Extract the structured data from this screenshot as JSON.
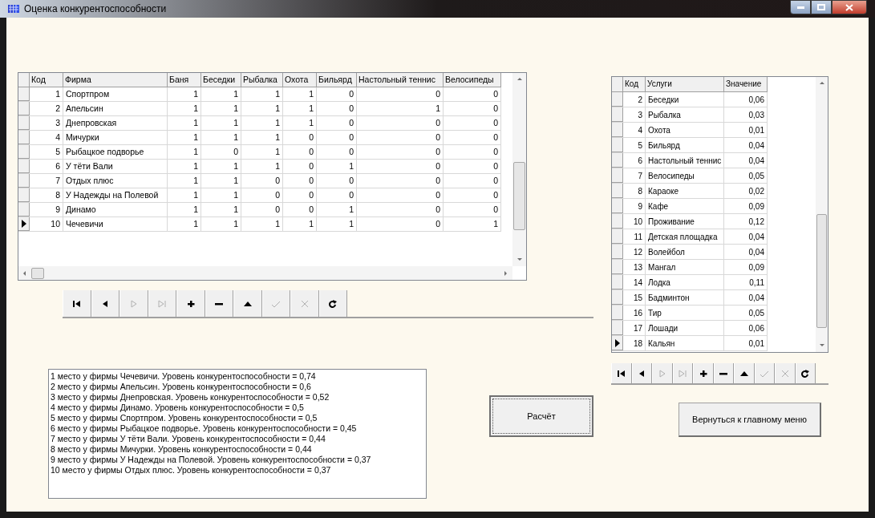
{
  "window": {
    "title": "Оценка конкурентоспособности"
  },
  "firms_grid": {
    "columns": [
      {
        "label": "Код",
        "kind": "number"
      },
      {
        "label": "Фирма",
        "kind": "text"
      },
      {
        "label": "Баня",
        "kind": "number"
      },
      {
        "label": "Беседки",
        "kind": "number"
      },
      {
        "label": "Рыбалка",
        "kind": "number"
      },
      {
        "label": "Охота",
        "kind": "number"
      },
      {
        "label": "Бильярд",
        "kind": "number"
      },
      {
        "label": "Настольный теннис",
        "kind": "number"
      },
      {
        "label": "Велосипеды",
        "kind": "number"
      }
    ],
    "rows": [
      {
        "cells": [
          "1",
          "Спортпром",
          "1",
          "1",
          "1",
          "1",
          "0",
          "0",
          "0"
        ],
        "selected": false
      },
      {
        "cells": [
          "2",
          "Апельсин",
          "1",
          "1",
          "1",
          "1",
          "0",
          "1",
          "0"
        ],
        "selected": false
      },
      {
        "cells": [
          "3",
          "Днепровская",
          "1",
          "1",
          "1",
          "1",
          "0",
          "0",
          "0"
        ],
        "selected": false
      },
      {
        "cells": [
          "4",
          "Мичурки",
          "1",
          "1",
          "1",
          "0",
          "0",
          "0",
          "0"
        ],
        "selected": false
      },
      {
        "cells": [
          "5",
          "Рыбацкое подворье",
          "1",
          "0",
          "1",
          "0",
          "0",
          "0",
          "0"
        ],
        "selected": false
      },
      {
        "cells": [
          "6",
          "У тёти Вали",
          "1",
          "1",
          "1",
          "0",
          "1",
          "0",
          "0"
        ],
        "selected": false
      },
      {
        "cells": [
          "7",
          "Отдых плюс",
          "1",
          "1",
          "0",
          "0",
          "0",
          "0",
          "0"
        ],
        "selected": false
      },
      {
        "cells": [
          "8",
          "У Надежды на Полевой",
          "1",
          "1",
          "0",
          "0",
          "0",
          "0",
          "0"
        ],
        "selected": false
      },
      {
        "cells": [
          "9",
          "Динамо",
          "1",
          "1",
          "0",
          "0",
          "1",
          "0",
          "0"
        ],
        "selected": false
      },
      {
        "cells": [
          "10",
          "Чечевичи",
          "1",
          "1",
          "1",
          "1",
          "1",
          "0",
          "1"
        ],
        "selected": true
      }
    ]
  },
  "firms_navigator": [
    {
      "kind": "first",
      "disabled": false
    },
    {
      "kind": "prior",
      "disabled": false
    },
    {
      "kind": "next",
      "disabled": true
    },
    {
      "kind": "last",
      "disabled": true
    },
    {
      "kind": "insert",
      "disabled": false
    },
    {
      "kind": "delete",
      "disabled": false
    },
    {
      "kind": "edit",
      "disabled": false
    },
    {
      "kind": "post",
      "disabled": true
    },
    {
      "kind": "cancel",
      "disabled": true
    },
    {
      "kind": "refresh",
      "disabled": false
    }
  ],
  "results": [
    "1 место у фирмы Чечевичи. Уровень конкурентоспособности = 0,74",
    "2 место у фирмы Апельсин. Уровень конкурентоспособности = 0,6",
    "3 место у фирмы Днепровская. Уровень конкурентоспособности = 0,52",
    "4 место у фирмы Динамо. Уровень конкурентоспособности = 0,5",
    "5 место у фирмы Спортпром. Уровень конкурентоспособности = 0,5",
    "6 место у фирмы Рыбацкое подворье. Уровень конкурентоспособности = 0,45",
    "7 место у фирмы У тёти Вали. Уровень конкурентоспособности = 0,44",
    "8 место у фирмы Мичурки. Уровень конкурентоспособности = 0,44",
    "9 место у фирмы У Надежды на Полевой. Уровень конкурентоспособности = 0,37",
    "10 место у фирмы Отдых плюс. Уровень конкурентоспособности = 0,37"
  ],
  "calculate_button": "Расчёт",
  "services_grid": {
    "columns": [
      {
        "label": "Код",
        "kind": "number"
      },
      {
        "label": "Услуги",
        "kind": "text"
      },
      {
        "label": "Значение",
        "kind": "number"
      }
    ],
    "rows": [
      {
        "cells": [
          "2",
          "Беседки",
          "0,06"
        ],
        "selected": false
      },
      {
        "cells": [
          "3",
          "Рыбалка",
          "0,03"
        ],
        "selected": false
      },
      {
        "cells": [
          "4",
          "Охота",
          "0,01"
        ],
        "selected": false
      },
      {
        "cells": [
          "5",
          "Бильярд",
          "0,04"
        ],
        "selected": false
      },
      {
        "cells": [
          "6",
          "Настольный теннис",
          "0,04"
        ],
        "selected": false
      },
      {
        "cells": [
          "7",
          "Велосипеды",
          "0,05"
        ],
        "selected": false
      },
      {
        "cells": [
          "8",
          "Караоке",
          "0,02"
        ],
        "selected": false
      },
      {
        "cells": [
          "9",
          "Кафе",
          "0,09"
        ],
        "selected": false
      },
      {
        "cells": [
          "10",
          "Проживание",
          "0,12"
        ],
        "selected": false
      },
      {
        "cells": [
          "11",
          "Детская площадка",
          "0,04"
        ],
        "selected": false
      },
      {
        "cells": [
          "12",
          "Волейбол",
          "0,04"
        ],
        "selected": false
      },
      {
        "cells": [
          "13",
          "Мангал",
          "0,09"
        ],
        "selected": false
      },
      {
        "cells": [
          "14",
          "Лодка",
          "0,11"
        ],
        "selected": false
      },
      {
        "cells": [
          "15",
          "Бадминтон",
          "0,04"
        ],
        "selected": false
      },
      {
        "cells": [
          "16",
          "Тир",
          "0,05"
        ],
        "selected": false
      },
      {
        "cells": [
          "17",
          "Лошади",
          "0,06"
        ],
        "selected": false
      },
      {
        "cells": [
          "18",
          "Кальян",
          "0,01"
        ],
        "selected": true
      }
    ]
  },
  "services_navigator": [
    {
      "kind": "first",
      "disabled": false
    },
    {
      "kind": "prior",
      "disabled": false
    },
    {
      "kind": "next",
      "disabled": true
    },
    {
      "kind": "last",
      "disabled": true
    },
    {
      "kind": "insert",
      "disabled": false
    },
    {
      "kind": "delete",
      "disabled": false
    },
    {
      "kind": "edit",
      "disabled": false
    },
    {
      "kind": "post",
      "disabled": true
    },
    {
      "kind": "cancel",
      "disabled": true
    },
    {
      "kind": "refresh",
      "disabled": false
    }
  ],
  "back_button": "Вернуться к главному меню"
}
